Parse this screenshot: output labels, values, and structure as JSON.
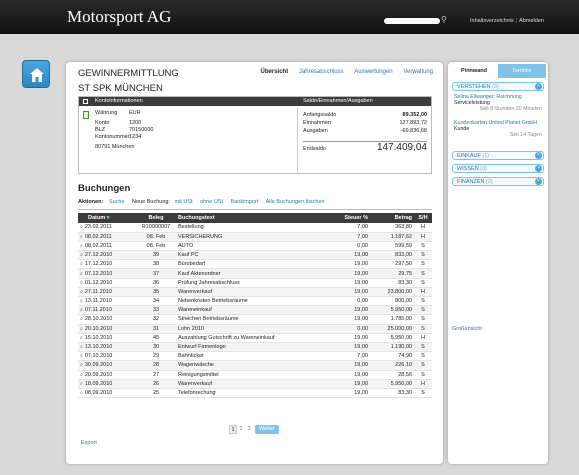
{
  "header": {
    "brand": "Motorsport AG",
    "links": [
      "Inhaltsverzeichnis",
      "Abmelden"
    ]
  },
  "main": {
    "title": "GEWINNERMITTLUNG",
    "tabs": [
      {
        "label": "Übersicht",
        "active": true
      },
      {
        "label": "Jahresabschluss",
        "active": false
      },
      {
        "label": "Auswertungen",
        "active": false
      },
      {
        "label": "Verwaltung",
        "active": false
      }
    ],
    "subtitle": "ST SPK MÜNCHEN",
    "account": {
      "head_left": "Kontoinformationen",
      "head_right": "Saldo/Einnahmen/Ausgaben",
      "waehrung_label": "Währung",
      "waehrung": "EUR",
      "konto_label": "Konto",
      "konto": "1200",
      "blz_label": "BLZ",
      "blz": "70150000",
      "kontonummer_label": "Kontonummer",
      "kontonummer": "1234",
      "bank": "80791 München",
      "anfangssaldo_label": "Anfangssaldo",
      "anfangssaldo": "89.352,00",
      "einnahmen_label": "Einnahmen",
      "einnahmen": "127.893,72",
      "ausgaben_label": "Ausgaben",
      "ausgaben": "-69.836,68",
      "endsaldo_label": "Endsaldo",
      "endsaldo": "147.409,04"
    },
    "bookings_title": "Buchungen",
    "actions": {
      "label": "Aktionen:",
      "search": "Suche",
      "new_label": "Neue Buchung:",
      "with_vat": "mit USt",
      "without_vat": "ohne USt",
      "bank_import": "Bankimport",
      "delete_all": "Alle Buchungen löschen"
    },
    "table": {
      "headers": [
        "Datum",
        "Beleg",
        "Buchungstext",
        "Steuer %",
        "Betrag",
        "S/H"
      ],
      "rows": [
        [
          "23.02.2011",
          "R10000007",
          "Bestellung",
          "7,00",
          "363,80",
          "H"
        ],
        [
          "08.02.2011",
          "08. Feb",
          "VERSICHERUNG",
          "7,00",
          "1.187,62",
          "H"
        ],
        [
          "08.02.2011",
          "08. Feb",
          "AUTO",
          "0,00",
          "599,59",
          "S"
        ],
        [
          "27.12.2010",
          "39",
          "Kauf PC",
          "19,00",
          "833,00",
          "S"
        ],
        [
          "17.12.2010",
          "38",
          "Bürobedarf",
          "19,00",
          "297,50",
          "S"
        ],
        [
          "07.12.2010",
          "37",
          "Kauf Aktenordner",
          "19,00",
          "29,75",
          "S"
        ],
        [
          "01.12.2010",
          "36",
          "Prüfung Jahresabschluss",
          "19,00",
          "83,30",
          "S"
        ],
        [
          "27.11.2010",
          "35",
          "Warenverkauf",
          "19,00",
          "23.800,00",
          "H"
        ],
        [
          "13.11.2010",
          "34",
          "Nebenkosten Betriebsräume",
          "0,00",
          "800,00",
          "S"
        ],
        [
          "07.11.2010",
          "33",
          "Wareneinkauf",
          "19,00",
          "5.950,00",
          "S"
        ],
        [
          "28.10.2010",
          "32",
          "Streichen Betriebsräume",
          "19,00",
          "1.785,00",
          "S"
        ],
        [
          "20.10.2010",
          "31",
          "Lohn 2010",
          "0,00",
          "25.000,00",
          "S"
        ],
        [
          "15.10.2010",
          "45",
          "Auszahlung Gutschrift zu Wareneinkauf",
          "19,00",
          "5.950,00",
          "H"
        ],
        [
          "13.10.2010",
          "30",
          "Entwurf Firmenlogo",
          "19,00",
          "1.190,00",
          "S"
        ],
        [
          "07.10.2010",
          "29",
          "Bahnticket",
          "7,00",
          "74,90",
          "S"
        ],
        [
          "30.09.2010",
          "28",
          "Wagenwäsche",
          "19,00",
          "226,10",
          "S"
        ],
        [
          "20.09.2010",
          "27",
          "Reinigungsmittel",
          "19,00",
          "28,56",
          "S"
        ],
        [
          "18.09.2010",
          "26",
          "Warenverkauf",
          "19,00",
          "5.950,00",
          "H"
        ],
        [
          "08.09.2010",
          "25",
          "Telefonrechung",
          "19,00",
          "83,30",
          "S"
        ]
      ]
    },
    "pager": {
      "pages": [
        "1",
        "2",
        "3"
      ],
      "current": "1",
      "next": "Weiter"
    },
    "export": "Export"
  },
  "side": {
    "tabs": [
      "Pinnwand",
      "Termine"
    ],
    "bars": [
      {
        "label": "VERSTEHEN",
        "count": "(3)",
        "icon": "chevron-up"
      },
      {
        "label": "EINKAUF",
        "count": "(1)",
        "icon": "chevron-down"
      },
      {
        "label": "WISSEN",
        "count": "(3)",
        "icon": "chevron-down"
      },
      {
        "label": "FINANZEN",
        "count": "(2)",
        "icon": "chevron-down"
      }
    ],
    "note1": {
      "title": "Selina Ellwanger: Reichnung",
      "text": "Serviceleistung",
      "meta": "Seit 8 Stunden 20 Minuten"
    },
    "note2": {
      "title": "Kundenkarten United Planet GmbH",
      "text": "Kunde",
      "meta": "Seit 14 Tagen"
    },
    "gross": "Großansicht"
  },
  "colors": {
    "accent": "#2c78b0",
    "header_bg": "#3b3b3b",
    "tab_blue": "#7fc4e8"
  }
}
